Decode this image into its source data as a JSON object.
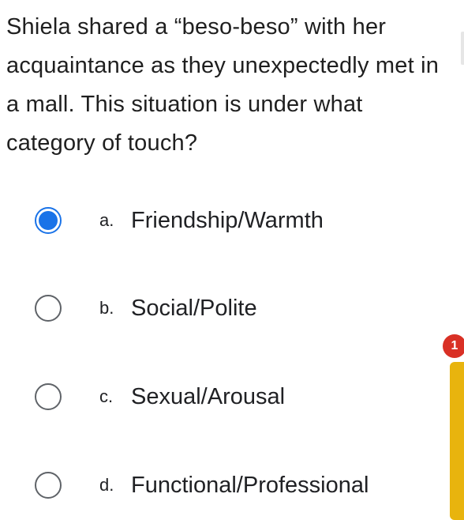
{
  "question": {
    "text": "Shiela shared a “beso-beso” with her acquaintance as they unexpectedly met in a mall. This situation is under what category of touch?"
  },
  "options": [
    {
      "letter": "a.",
      "label": "Friendship/Warmth",
      "selected": true
    },
    {
      "letter": "b.",
      "label": "Social/Polite",
      "selected": false
    },
    {
      "letter": "c.",
      "label": "Sexual/Arousal",
      "selected": false
    },
    {
      "letter": "d.",
      "label": "Functional/Professional",
      "selected": false
    }
  ],
  "side_badge": {
    "label": "1"
  },
  "colors": {
    "accent": "#1a73e8",
    "badge": "#d93025",
    "side_tab": "#e8b40e"
  }
}
